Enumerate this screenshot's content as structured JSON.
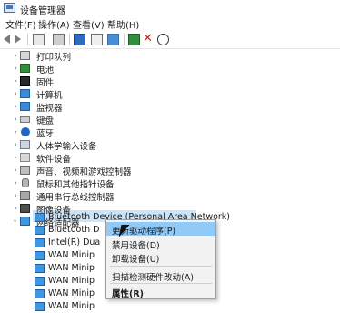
{
  "window": {
    "title": "设备管理器"
  },
  "menu": [
    {
      "label": "文件(F)"
    },
    {
      "label": "操作(A)"
    },
    {
      "label": "查看(V)"
    },
    {
      "label": "帮助(H)"
    }
  ],
  "toolbar": {
    "icons": [
      "back-arrow-icon",
      "forward-arrow-icon",
      "properties-icon",
      "view-icon",
      "help-icon",
      "show-hidden-icon",
      "monitor-icon",
      "add-driver-icon",
      "uninstall-x-icon",
      "download-icon"
    ]
  },
  "tree": {
    "categories": [
      {
        "label": "打印队列",
        "icon": "printer-icon"
      },
      {
        "label": "电池",
        "icon": "battery-icon"
      },
      {
        "label": "固件",
        "icon": "chip-icon"
      },
      {
        "label": "计算机",
        "icon": "computer-icon"
      },
      {
        "label": "监视器",
        "icon": "monitor-icon"
      },
      {
        "label": "键盘",
        "icon": "keyboard-icon"
      },
      {
        "label": "蓝牙",
        "icon": "bluetooth-icon"
      },
      {
        "label": "人体学输入设备",
        "icon": "hid-icon"
      },
      {
        "label": "软件设备",
        "icon": "software-device-icon"
      },
      {
        "label": "声音、视频和游戏控制器",
        "icon": "audio-icon"
      },
      {
        "label": "鼠标和其他指针设备",
        "icon": "mouse-icon"
      },
      {
        "label": "通用串行总线控制器",
        "icon": "usb-icon"
      },
      {
        "label": "图像设备",
        "icon": "camera-icon"
      },
      {
        "label": "网络适配器",
        "icon": "network-adapter-icon"
      }
    ],
    "network_adapters": [
      {
        "label": "Bluetooth Device (Personal Area Network)"
      },
      {
        "label": "Bluetooth D"
      },
      {
        "label": "Intel(R) Dua"
      },
      {
        "label": "WAN Minip"
      },
      {
        "label": "WAN Minip"
      },
      {
        "label": "WAN Minip"
      },
      {
        "label": "WAN Minip"
      },
      {
        "label": "WAN Minip"
      }
    ]
  },
  "context_menu": {
    "items": [
      {
        "label": "更新驱动程序(P)"
      },
      {
        "label": "禁用设备(D)"
      },
      {
        "label": "卸载设备(U)"
      },
      {
        "label": "扫描检测硬件改动(A)"
      },
      {
        "label": "属性(R)"
      }
    ]
  },
  "colors": {
    "selection": "#cce4f7",
    "menu_highlight": "#91c9f7",
    "accent_blue": "#1f66c7",
    "uninstall_red": "#d22020",
    "add_green": "#2f8f3a"
  }
}
